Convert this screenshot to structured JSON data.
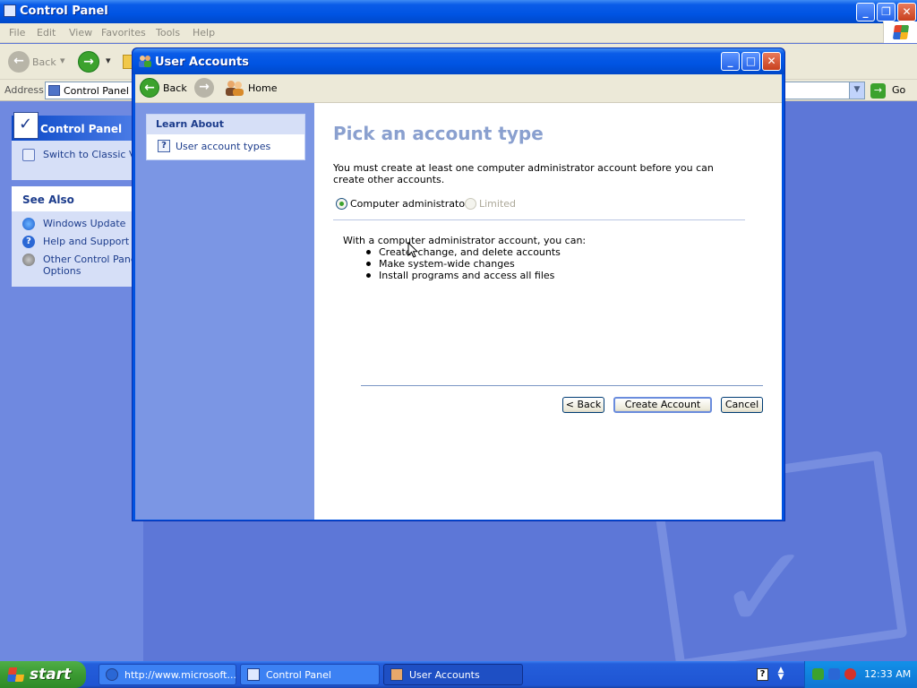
{
  "control_panel": {
    "title": "Control Panel",
    "menu": [
      "File",
      "Edit",
      "View",
      "Favorites",
      "Tools",
      "Help"
    ],
    "toolbar": {
      "back_label": "Back"
    },
    "address": {
      "label": "Address",
      "value": "Control Panel",
      "go_label": "Go"
    },
    "task_pane": {
      "main_title": "Control Panel",
      "switch_label": "Switch to Classic View",
      "see_also_title": "See Also",
      "see_also": [
        "Windows Update",
        "Help and Support",
        "Other Control Panel",
        "Options"
      ]
    }
  },
  "user_accounts": {
    "title": "User Accounts",
    "nav": {
      "back_label": "Back",
      "home_label": "Home"
    },
    "sidebar": {
      "learn_about": "Learn About",
      "link": "User account types"
    },
    "heading": "Pick an account type",
    "intro": "You must create at least one computer administrator account before you can create other accounts.",
    "radio": {
      "admin_label": "Computer administrator",
      "limited_label": "Limited",
      "selected": "Computer administrator"
    },
    "description_title": "With a computer administrator account, you can:",
    "bullets": [
      "Create, change, and delete accounts",
      "Make system-wide changes",
      "Install programs and access all files"
    ],
    "buttons": {
      "back": "< Back",
      "create": "Create Account",
      "cancel": "Cancel"
    }
  },
  "taskbar": {
    "start": "start",
    "tasks": [
      "http://www.microsoft...",
      "Control Panel",
      "User Accounts"
    ],
    "clock": "12:33 AM"
  },
  "colors": {
    "title_blue": "#0054e3",
    "heading": "#8aa0cf",
    "start_green": "#3b9a32"
  }
}
